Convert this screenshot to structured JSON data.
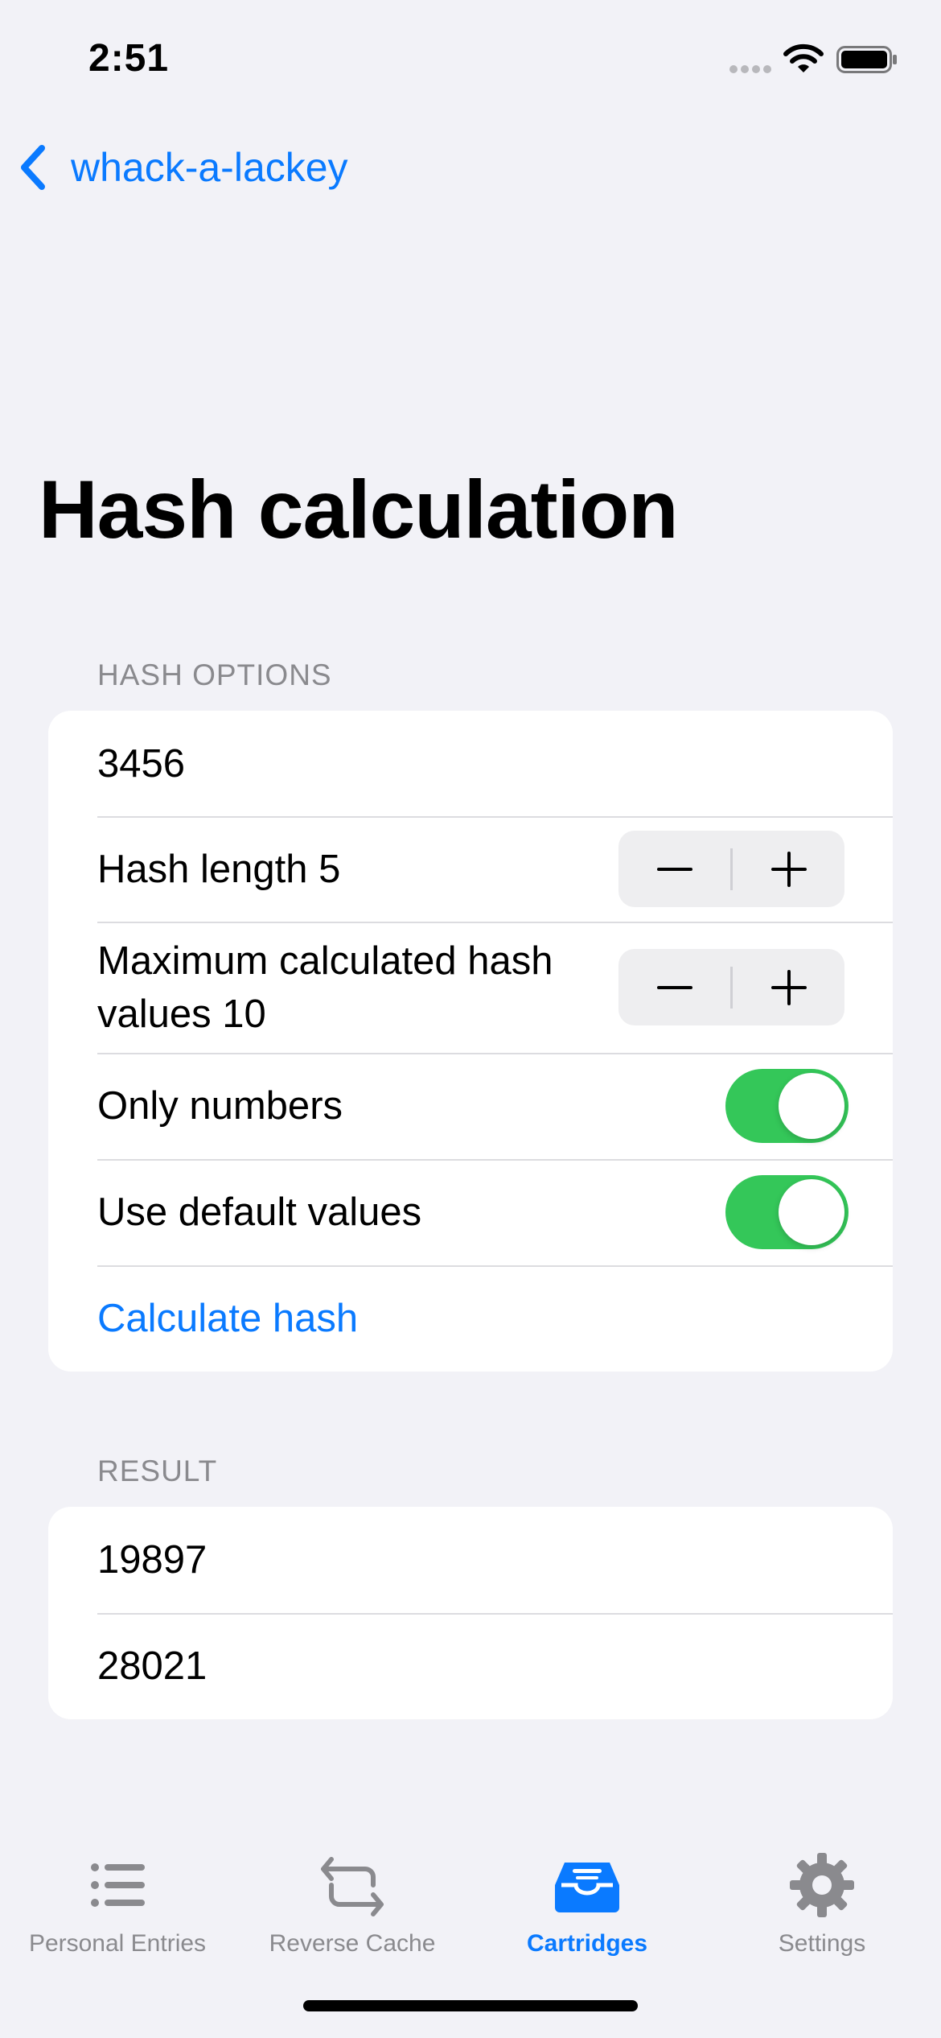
{
  "status_bar": {
    "time": "2:51",
    "icons": [
      "signal-dots-icon",
      "wifi-icon",
      "battery-icon"
    ]
  },
  "nav": {
    "back_label": "whack-a-lackey",
    "back_icon": "chevron-left-icon"
  },
  "page_title": "Hash calculation",
  "hash_options": {
    "header": "HASH OPTIONS",
    "input_value": "3456",
    "hash_length_label": "Hash length 5",
    "max_values_label": "Maximum calculated hash values 10",
    "only_numbers_label": "Only numbers",
    "only_numbers_on": true,
    "use_default_label": "Use default values",
    "use_default_on": true,
    "calculate_label": "Calculate hash"
  },
  "result": {
    "header": "RESULT",
    "values": [
      "19897",
      "28021"
    ]
  },
  "tab_bar": {
    "tabs": [
      {
        "label": "Personal Entries",
        "icon": "list-icon",
        "active": false
      },
      {
        "label": "Reverse Cache",
        "icon": "repeat-arrows-icon",
        "active": false
      },
      {
        "label": "Cartridges",
        "icon": "tray-icon",
        "active": true
      },
      {
        "label": "Settings",
        "icon": "gear-icon",
        "active": false
      }
    ]
  },
  "colors": {
    "accent": "#0a7aff",
    "toggle_on": "#34c759",
    "background": "#f2f2f7",
    "secondary_text": "#8a8a8e"
  }
}
